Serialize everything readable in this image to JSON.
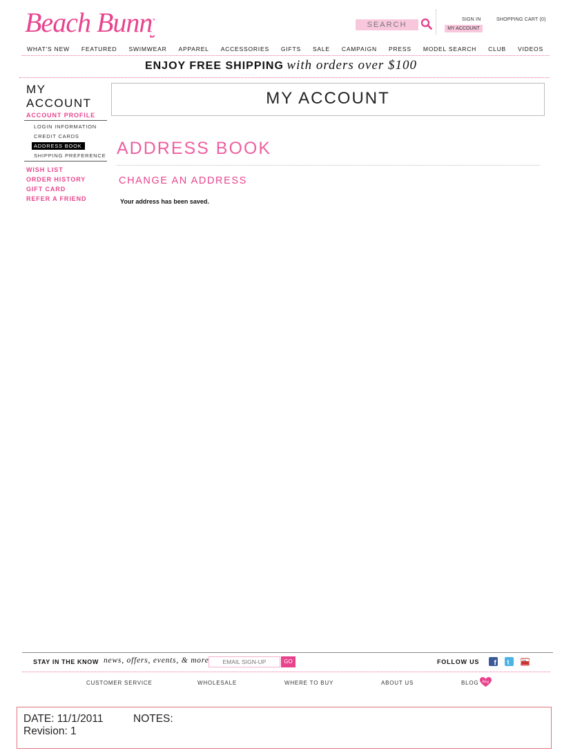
{
  "brand": {
    "name": "Beach Bunny",
    "logo_color": "#e8448e"
  },
  "header": {
    "search_placeholder": "SEARCH",
    "sign_in": "SIGN IN",
    "my_account": "MY ACCOUNT",
    "cart": "SHOPPING CART (0)"
  },
  "nav": {
    "items": [
      "WHAT'S NEW",
      "FEATURED",
      "SWIMWEAR",
      "APPAREL",
      "ACCESSORIES",
      "GIFTS",
      "SALE",
      "CAMPAIGN",
      "PRESS",
      "MODEL SEARCH",
      "CLUB",
      "VIDEOS"
    ]
  },
  "promo": {
    "bold": "ENJOY FREE SHIPPING",
    "italic": "with orders over $100"
  },
  "sidebar": {
    "title_line1": "MY",
    "title_line2": "ACCOUNT",
    "section": "ACCOUNT PROFILE",
    "sub_items": [
      "LOGIN INFORMATION",
      "CREDIT CARDS",
      "ADDRESS BOOK",
      "SHIPPING PREFERENCE"
    ],
    "active_sub": "ADDRESS BOOK",
    "links": [
      "WISH LIST",
      "ORDER HISTORY",
      "GIFT CARD",
      "REFER A FRIEND"
    ]
  },
  "main": {
    "title": "MY ACCOUNT",
    "section_title": "ADDRESS BOOK",
    "subsection_title": "CHANGE AN ADDRESS",
    "message": "Your address has been saved."
  },
  "footer": {
    "stay_bold": "STAY IN THE KNOW",
    "stay_italic": "news, offers, events, & more",
    "email_placeholder": "EMAIL SIGN-UP",
    "go": "GO",
    "follow": "FOLLOW US",
    "social": [
      "facebook-icon",
      "twitter-icon",
      "youtube-icon"
    ],
    "links": [
      "CUSTOMER SERVICE",
      "WHOLESALE",
      "WHERE TO BUY",
      "ABOUT US",
      "BLOG"
    ],
    "blog_badge": "Blog"
  },
  "notes": {
    "date": "DATE: 11/1/2011",
    "notes_label": "NOTES:",
    "revision": "Revision: 1"
  },
  "colors": {
    "pink": "#e8448e",
    "light_pink": "#f8c7dc",
    "notes_border": "#e2707a"
  }
}
